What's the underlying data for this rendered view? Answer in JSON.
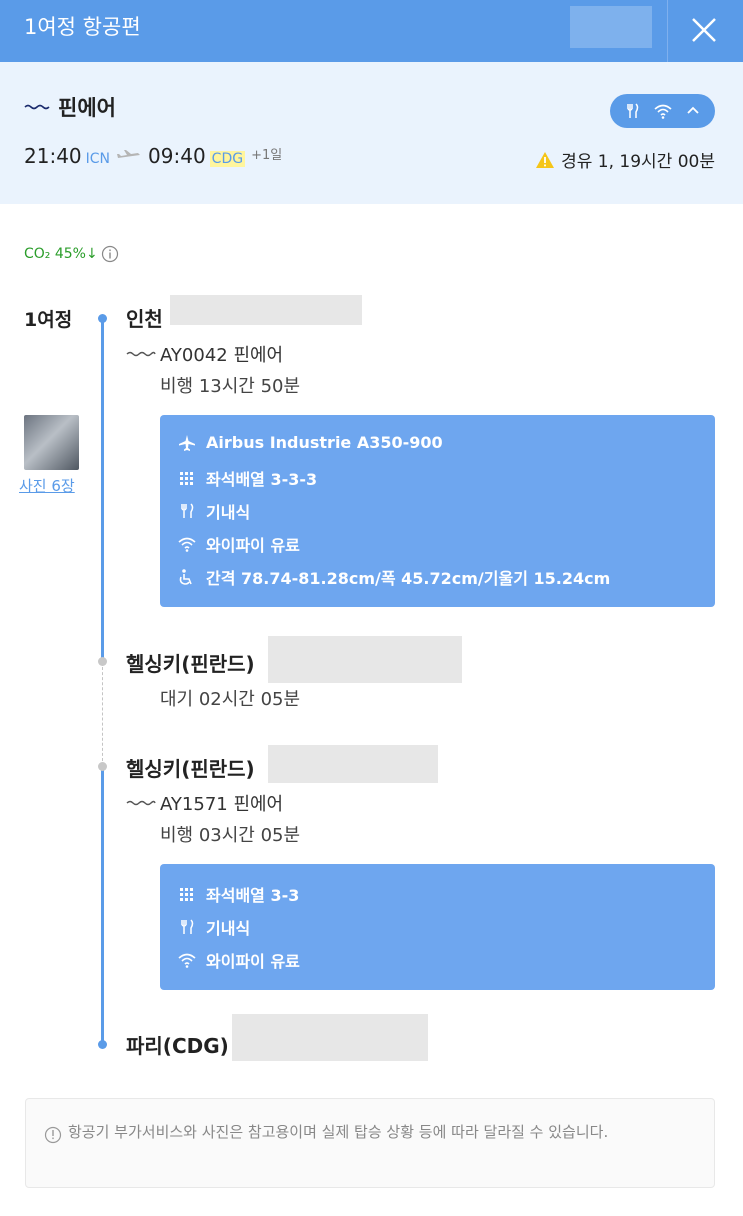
{
  "header": {
    "title": "1여정 항공편"
  },
  "summary": {
    "airline": "핀에어",
    "departure_time": "21:40",
    "departure_code": "ICN",
    "arrival_time": "09:40",
    "arrival_code": "CDG",
    "day_offset": "+1일",
    "layover_text": "경유 1, 19시간 00분",
    "amenity_icons": [
      "meal-icon",
      "wifi-icon",
      "chevron-up-icon"
    ]
  },
  "co2": {
    "text": "CO₂ 45%↓"
  },
  "itinerary": {
    "leg_label": "1여정",
    "photo_link": "사진 6장",
    "stops": [
      {
        "city": "인천"
      },
      {
        "city": "헬싱키(핀란드)"
      },
      {
        "city": "헬싱키(핀란드)"
      },
      {
        "city": "파리(CDG)"
      }
    ],
    "segments": [
      {
        "flight": "AY0042 핀에어",
        "duration": "비행 13시간 50분",
        "amenities": [
          {
            "icon": "plane-icon",
            "text": "Airbus Industrie A350-900"
          },
          {
            "icon": "seat-grid-icon",
            "text": "좌석배열 3-3-3"
          },
          {
            "icon": "meal-icon",
            "text": "기내식"
          },
          {
            "icon": "wifi-icon",
            "text": "와이파이 유료"
          },
          {
            "icon": "legroom-icon",
            "text": "간격 78.74-81.28cm/폭 45.72cm/기울기 15.24cm"
          }
        ]
      },
      {
        "flight": "AY1571 핀에어",
        "duration": "비행 03시간 05분",
        "amenities": [
          {
            "icon": "seat-grid-icon",
            "text": "좌석배열 3-3"
          },
          {
            "icon": "meal-icon",
            "text": "기내식"
          },
          {
            "icon": "wifi-icon",
            "text": "와이파이 유료"
          }
        ]
      }
    ],
    "wait": "대기 02시간 05분"
  },
  "notice": {
    "text": "항공기 부가서비스와 사진은 참고용이며 실제 탑승 상황 등에 따라 달라질 수 있습니다."
  },
  "colors": {
    "accent": "#5a9be8",
    "amenity_box": "#6ea6ef",
    "summary_bg": "#eaf3fd",
    "co2_green": "#2a9d2a",
    "highlight": "#fff59d"
  }
}
